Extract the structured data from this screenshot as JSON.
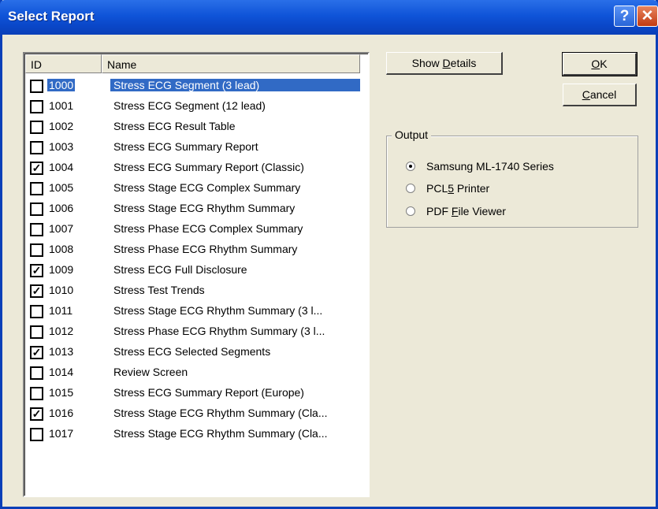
{
  "window": {
    "title": "Select Report"
  },
  "titlebar": {
    "help_glyph": "?",
    "close_glyph": "✕"
  },
  "list": {
    "columns": [
      "ID",
      "Name"
    ],
    "rows": [
      {
        "id": "1000",
        "name": "Stress ECG Segment (3 lead)",
        "checked": false,
        "selected": true
      },
      {
        "id": "1001",
        "name": "Stress ECG Segment (12 lead)",
        "checked": false
      },
      {
        "id": "1002",
        "name": "Stress ECG Result Table",
        "checked": false
      },
      {
        "id": "1003",
        "name": "Stress ECG Summary Report",
        "checked": false
      },
      {
        "id": "1004",
        "name": "Stress ECG Summary Report (Classic)",
        "checked": true
      },
      {
        "id": "1005",
        "name": "Stress Stage ECG Complex Summary",
        "checked": false
      },
      {
        "id": "1006",
        "name": "Stress Stage ECG Rhythm Summary",
        "checked": false
      },
      {
        "id": "1007",
        "name": "Stress Phase ECG Complex Summary",
        "checked": false
      },
      {
        "id": "1008",
        "name": "Stress Phase ECG Rhythm Summary",
        "checked": false
      },
      {
        "id": "1009",
        "name": "Stress ECG Full Disclosure",
        "checked": true
      },
      {
        "id": "1010",
        "name": "Stress Test Trends",
        "checked": true
      },
      {
        "id": "1011",
        "name": "Stress Stage ECG Rhythm Summary (3 l...",
        "checked": false
      },
      {
        "id": "1012",
        "name": "Stress Phase ECG Rhythm Summary (3 l...",
        "checked": false
      },
      {
        "id": "1013",
        "name": "Stress ECG Selected Segments",
        "checked": true
      },
      {
        "id": "1014",
        "name": "Review Screen",
        "checked": false
      },
      {
        "id": "1015",
        "name": "Stress ECG Summary Report (Europe)",
        "checked": false
      },
      {
        "id": "1016",
        "name": "Stress Stage ECG Rhythm Summary (Cla...",
        "checked": true
      },
      {
        "id": "1017",
        "name": "Stress Stage ECG Rhythm Summary (Cla...",
        "checked": false
      }
    ]
  },
  "buttons": {
    "show_details_pre": "Show ",
    "show_details_key": "D",
    "show_details_post": "etails",
    "ok_key": "O",
    "ok_post": "K",
    "cancel_key": "C",
    "cancel_post": "ancel"
  },
  "output": {
    "label": "Output",
    "options": [
      {
        "pre": "Samsung ML-1740 Series",
        "key": "",
        "post": "",
        "checked": true
      },
      {
        "pre": "PCL",
        "key": "5",
        "post": " Printer",
        "checked": false
      },
      {
        "pre": "PDF ",
        "key": "F",
        "post": "ile Viewer",
        "checked": false
      }
    ]
  },
  "colors": {
    "selection": "#316ac5",
    "titlebar": "#0a47c8"
  }
}
